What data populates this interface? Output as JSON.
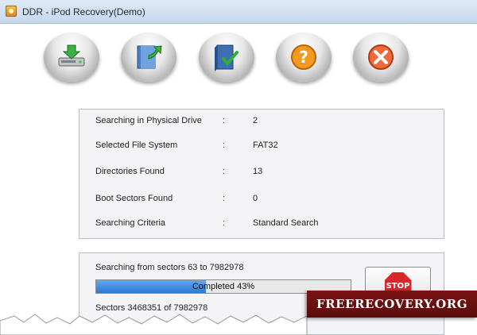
{
  "window": {
    "title": "DDR - iPod Recovery(Demo)"
  },
  "toolbar": {
    "buttons": [
      {
        "name": "drive-recovery",
        "icon": "drive-download-icon"
      },
      {
        "name": "open-folder",
        "icon": "folder-arrow-icon"
      },
      {
        "name": "save-check",
        "icon": "book-check-icon"
      },
      {
        "name": "help",
        "icon": "help-icon"
      },
      {
        "name": "exit",
        "icon": "close-icon"
      }
    ]
  },
  "info": {
    "rows": [
      {
        "label": "Searching in Physical Drive",
        "sep": ":",
        "value": "2"
      },
      {
        "label": "Selected File System",
        "sep": ":",
        "value": "FAT32"
      },
      {
        "label": "Directories Found",
        "sep": ":",
        "value": "13"
      },
      {
        "label": "Boot Sectors Found",
        "sep": ":",
        "value": "0"
      },
      {
        "label": "Searching Criteria",
        "sep": ":",
        "value": "Standard Search"
      }
    ]
  },
  "progress": {
    "range_text": "Searching from sectors  63 to 7982978",
    "bar_text": "Completed 43%",
    "percent": 43,
    "count_text": "Sectors  3468351 of 7982978",
    "stop_label": "STOP"
  },
  "watermark": {
    "text": "FREERECOVERY.ORG"
  },
  "colors": {
    "progress_fill": "#2e78d4",
    "stop": "#d8262b",
    "watermark_bg": "#6a1010"
  }
}
